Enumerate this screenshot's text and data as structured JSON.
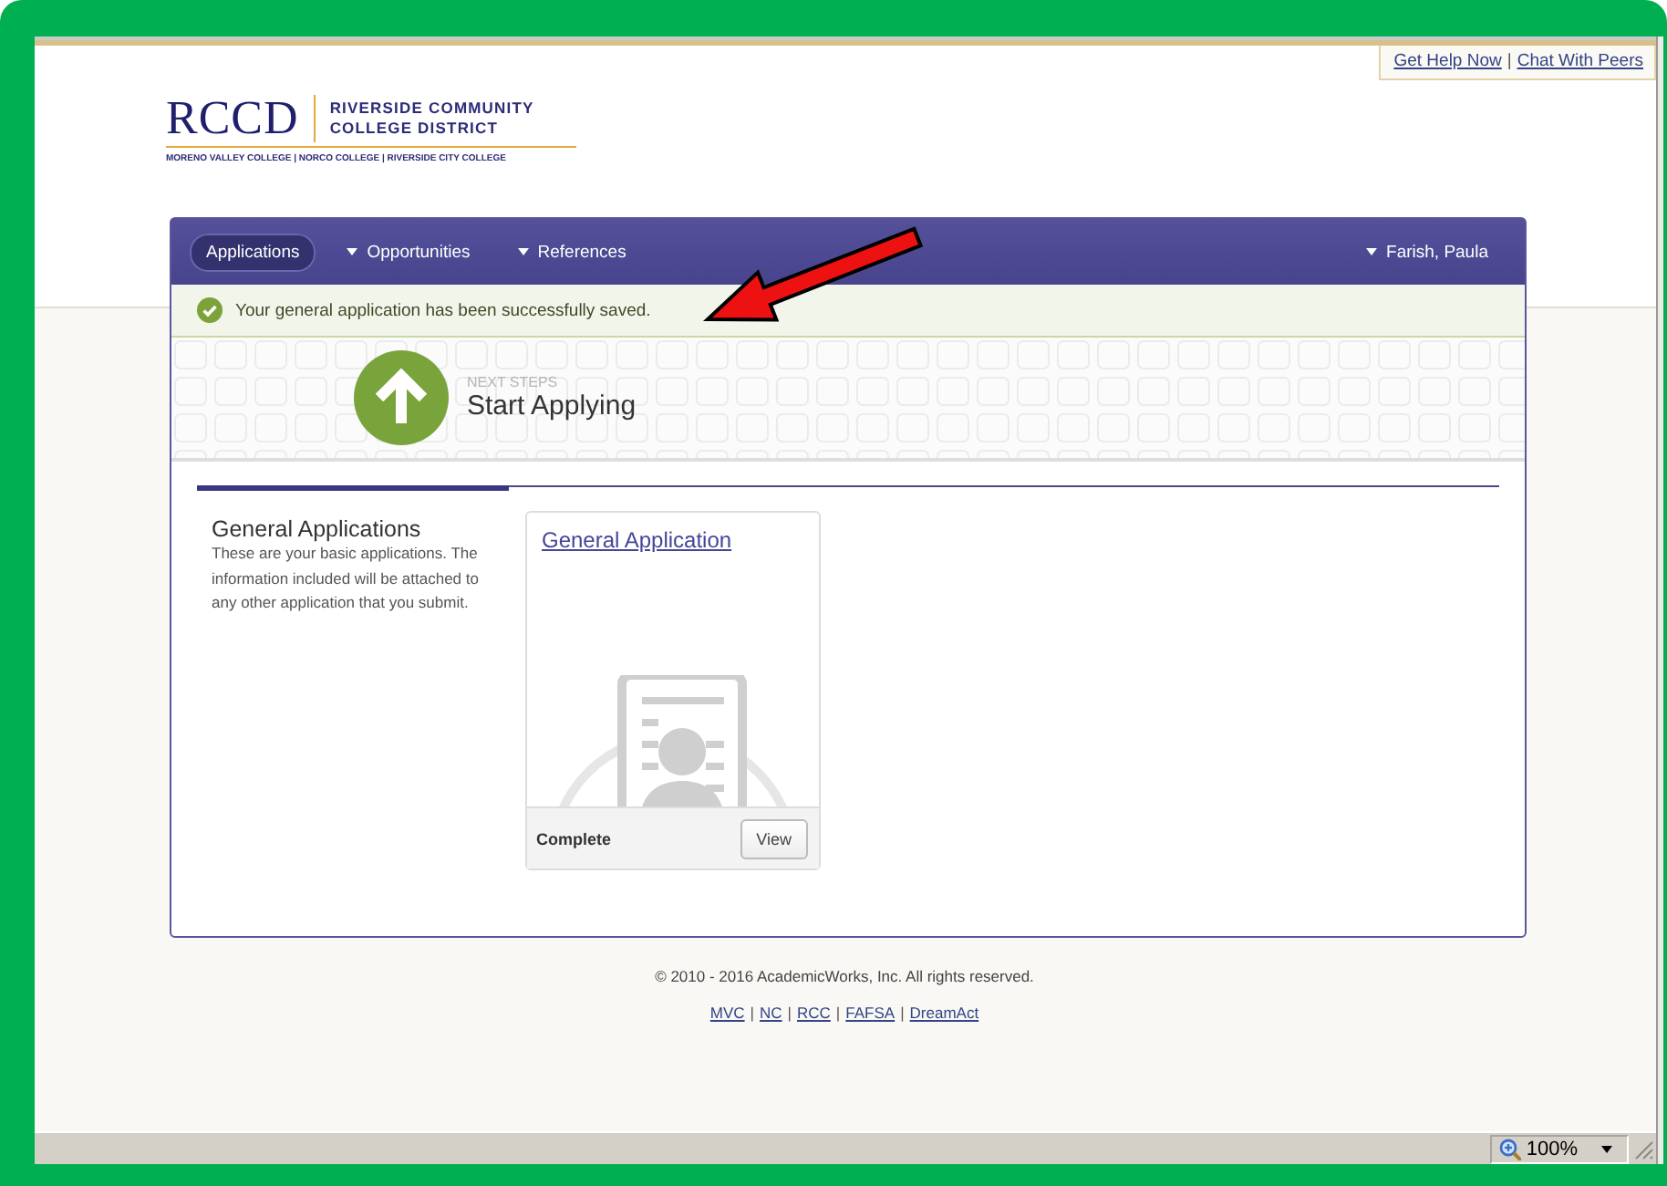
{
  "top_links": {
    "separator": "|",
    "items": [
      {
        "label": "Get Help Now"
      },
      {
        "label": "Chat With Peers"
      }
    ]
  },
  "logo": {
    "mark": "RCCD",
    "name_lines": [
      "RIVERSIDE COMMUNITY",
      "COLLEGE DISTRICT"
    ],
    "colleges": "MORENO VALLEY COLLEGE | NORCO COLLEGE | RIVERSIDE CITY COLLEGE"
  },
  "nav": {
    "tabs": [
      {
        "label": "Applications",
        "selected": true,
        "dropdown": false
      },
      {
        "label": "Opportunities",
        "selected": false,
        "dropdown": true
      },
      {
        "label": "References",
        "selected": false,
        "dropdown": true
      }
    ],
    "user": {
      "label": "Farish, Paula",
      "dropdown": true
    }
  },
  "alert": {
    "kind": "success",
    "message": "Your general application has been successfully saved."
  },
  "next_steps": {
    "eyebrow": "NEXT STEPS",
    "title": "Start Applying"
  },
  "section": {
    "title": "General Applications",
    "description": "These are your basic applications. The information included will be attached to any other application that you submit.",
    "cards": [
      {
        "title": "General Application",
        "status": "Complete",
        "button": "View"
      }
    ]
  },
  "footer": {
    "copyright": "© 2010 - 2016 AcademicWorks, Inc. All rights reserved.",
    "separator": "|",
    "links": [
      "MVC",
      "NC",
      "RCC",
      "FAFSA",
      "DreamAct"
    ]
  },
  "status_bar": {
    "zoom": "100%"
  }
}
